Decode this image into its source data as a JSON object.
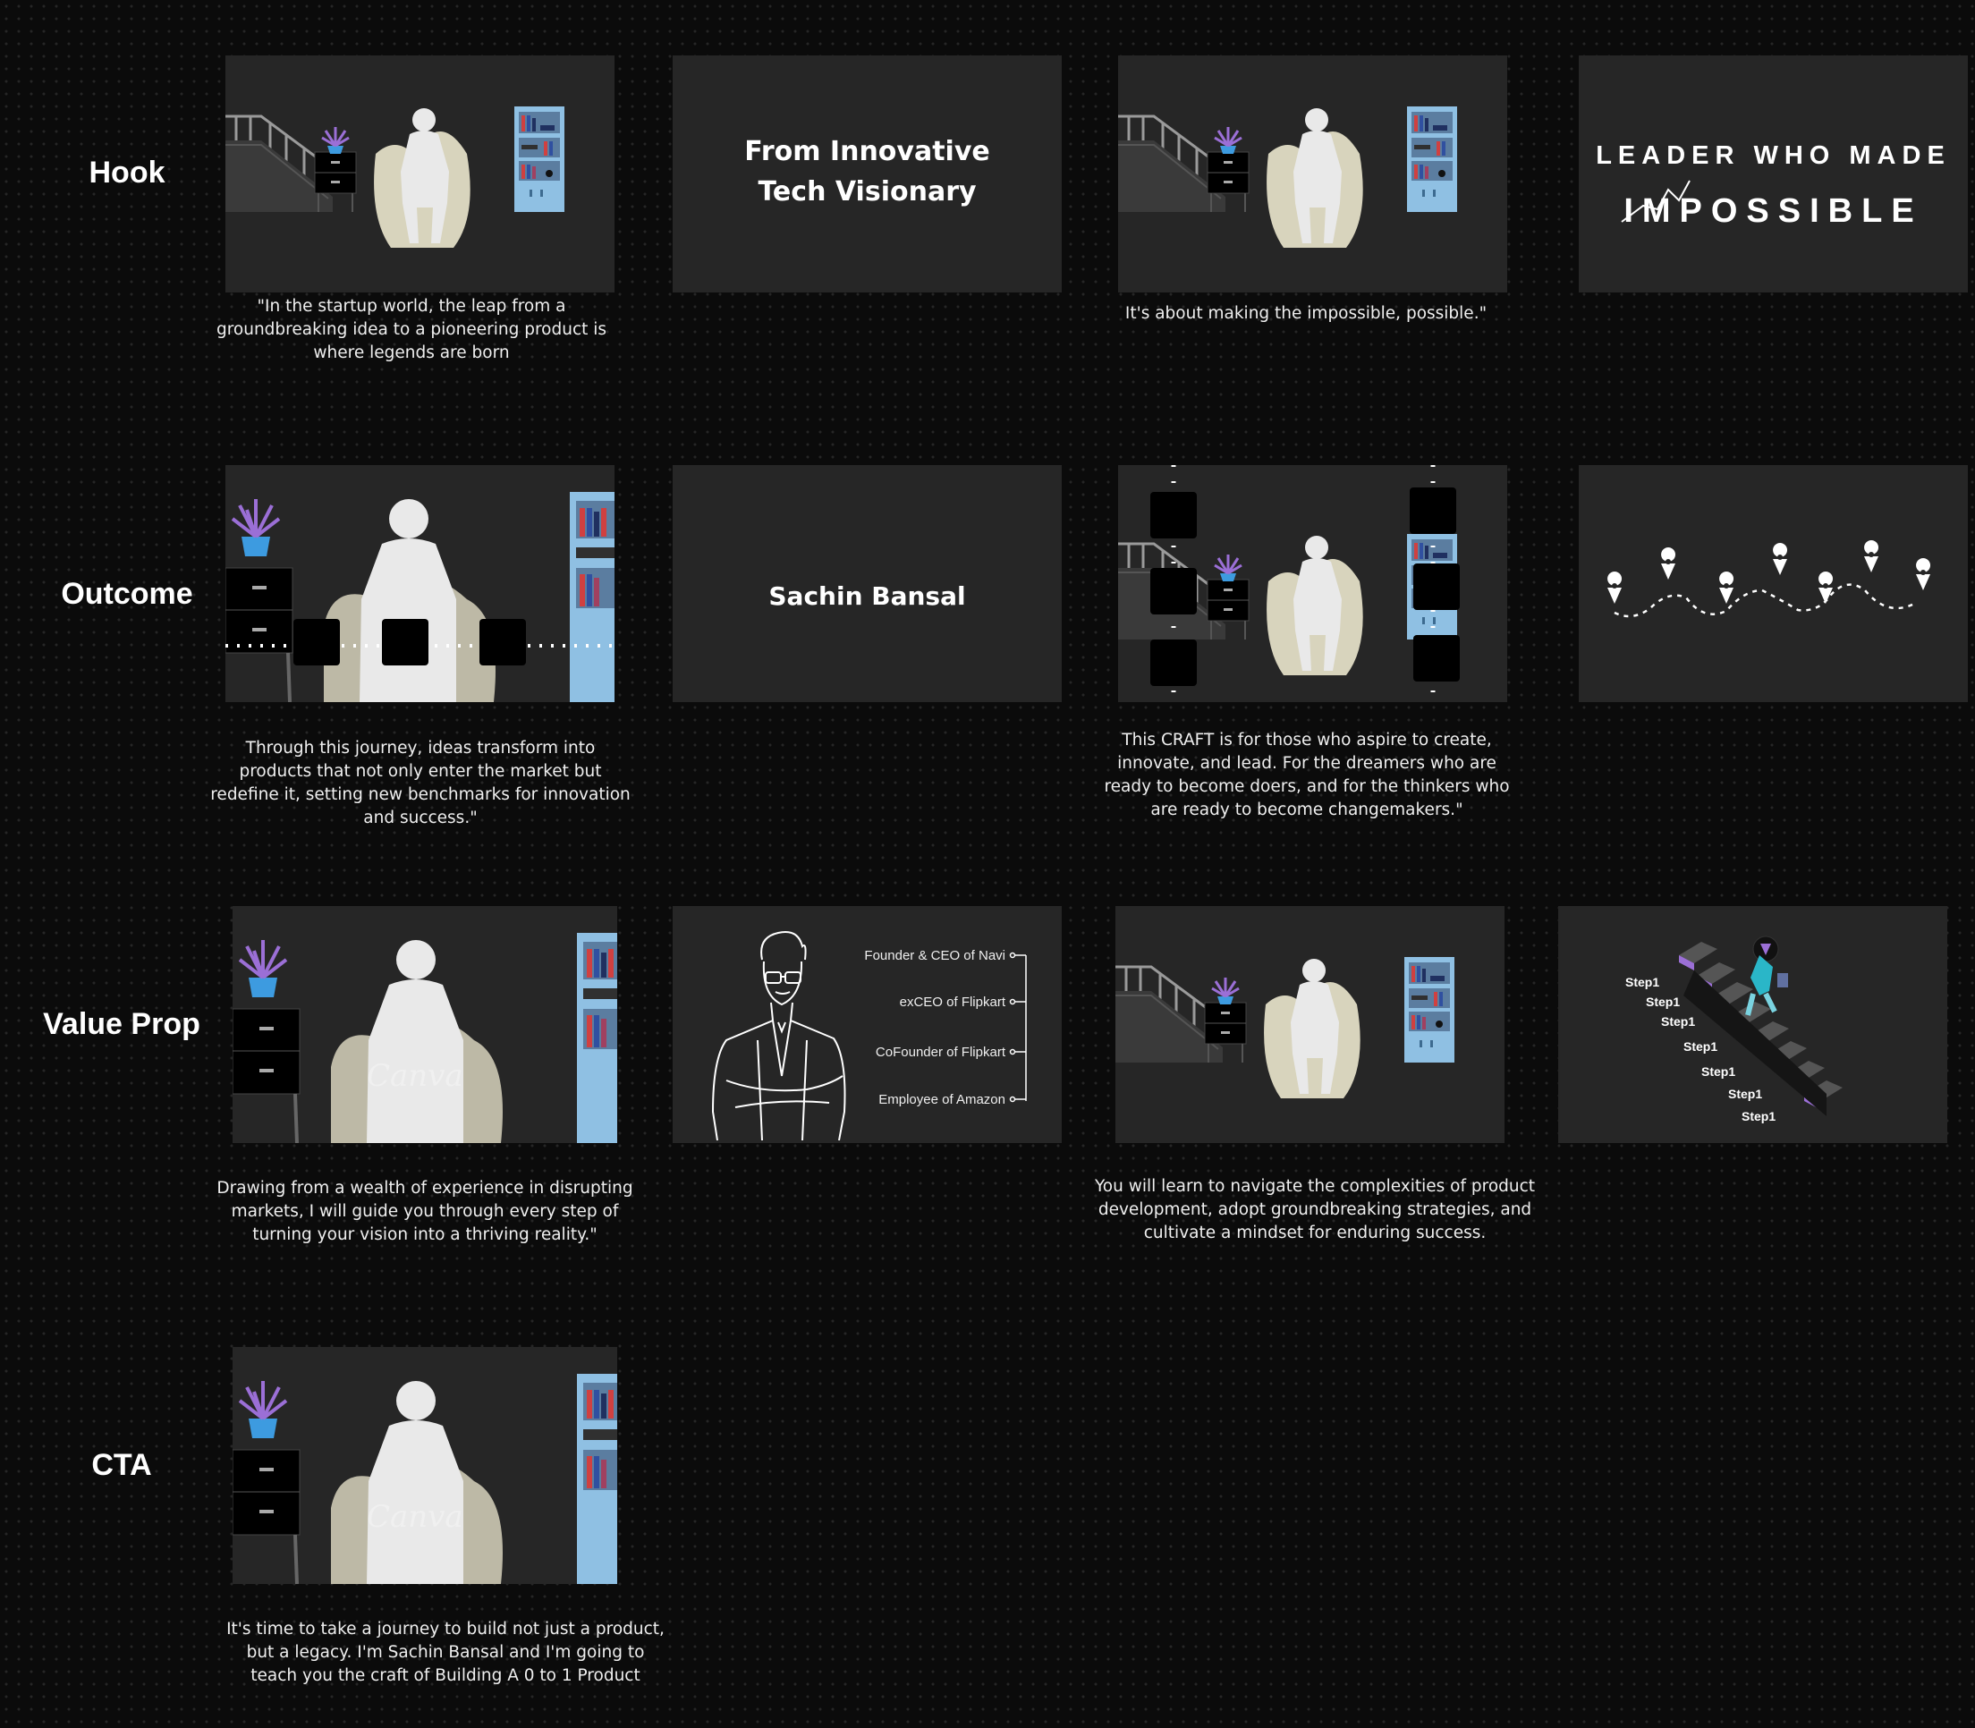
{
  "rows": {
    "hook": "Hook",
    "outcome": "Outcome",
    "value_prop": "Value Prop",
    "cta": "CTA"
  },
  "hook": {
    "frame2_title_line1": "From Innovative",
    "frame2_title_line2": "Tech Visionary",
    "frame4_line1": "LEADER WHO MADE",
    "frame4_line2": "IMPOSSIBLE",
    "caption1": "\"In the startup world, the leap from a groundbreaking idea to a pioneering product is where legends are born",
    "caption3": "It's about making the impossible, possible.\""
  },
  "outcome": {
    "frame2_title": "Sachin Bansal",
    "caption1": "Through this journey, ideas transform into products that not only enter the market but redefine it, setting new benchmarks for innovation and success.\"",
    "caption3": "This CRAFT is for those who aspire to create, innovate, and lead. For the dreamers who are ready to become doers, and for the thinkers who are ready to become changemakers.\""
  },
  "value_prop": {
    "roles": [
      "Founder & CEO of Navi",
      "exCEO of Flipkart",
      "CoFounder of Flipkart",
      "Employee of Amazon"
    ],
    "steps": [
      "Step1",
      "Step1",
      "Step1",
      "Step1",
      "Step1",
      "Step1",
      "Step1"
    ],
    "watermark": "Canva",
    "caption1": "Drawing from a wealth of experience in disrupting markets, I will guide you through every step of turning your vision into a thriving reality.\"",
    "caption3": "You will learn to navigate the complexities of product development, adopt groundbreaking strategies, and cultivate a mindset for enduring success."
  },
  "cta": {
    "watermark": "Canva",
    "caption1": "It's time to take a journey to build not just a product, but a legacy. I'm Sachin Bansal and I'm going to teach you the craft of Building A 0 to 1 Product"
  },
  "colors": {
    "frame_bg": "#262626",
    "page_bg": "#0b0b0b",
    "plant_purple": "#9b6fd6",
    "pot_blue": "#3d9be0",
    "shelf_blue": "#8fc0e3",
    "chair": "#d8d4bd",
    "person": "#e9e9e9"
  }
}
